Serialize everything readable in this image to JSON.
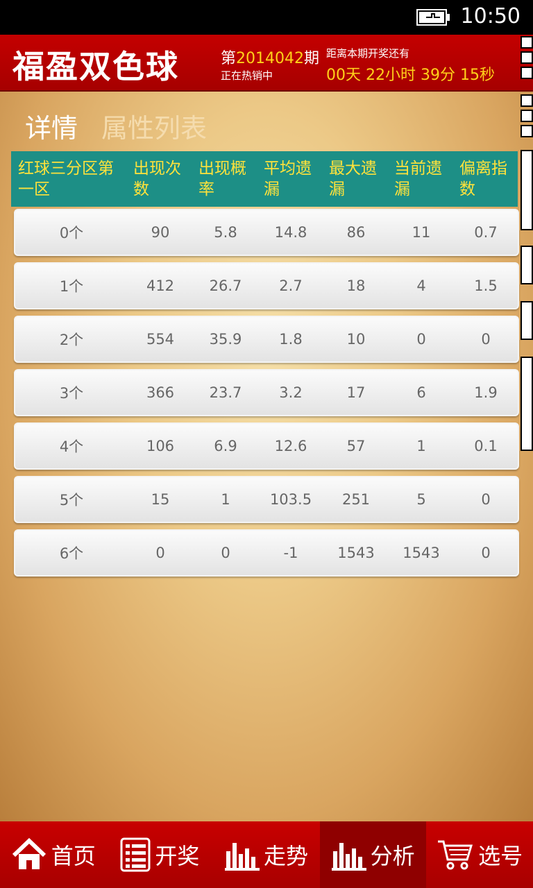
{
  "status": {
    "time": "10:50"
  },
  "header": {
    "title": "福盈双色球",
    "issue_prefix": "第",
    "issue_number": "2014042",
    "issue_suffix": "期",
    "issue_status": "正在热销中",
    "countdown_label": "距离本期开奖还有",
    "countdown": "00天 22小时 39分 15秒"
  },
  "pivot": {
    "tabs": [
      {
        "label": "详情",
        "active": true
      },
      {
        "label": "属性列表",
        "active": false
      }
    ]
  },
  "table": {
    "headers": [
      "红球三分区第一区",
      "出现次数",
      "出现概率",
      "平均遗漏",
      "最大遗漏",
      "当前遗漏",
      "偏离指数"
    ],
    "rows": [
      [
        "0个",
        "90",
        "5.8",
        "14.8",
        "86",
        "11",
        "0.7"
      ],
      [
        "1个",
        "412",
        "26.7",
        "2.7",
        "18",
        "4",
        "1.5"
      ],
      [
        "2个",
        "554",
        "35.9",
        "1.8",
        "10",
        "0",
        "0"
      ],
      [
        "3个",
        "366",
        "23.7",
        "3.2",
        "17",
        "6",
        "1.9"
      ],
      [
        "4个",
        "106",
        "6.9",
        "12.6",
        "57",
        "1",
        "0.1"
      ],
      [
        "5个",
        "15",
        "1",
        "103.5",
        "251",
        "5",
        "0"
      ],
      [
        "6个",
        "0",
        "0",
        "-1",
        "1543",
        "1543",
        "0"
      ]
    ]
  },
  "nav": {
    "items": [
      {
        "label": "首页",
        "icon": "home-icon"
      },
      {
        "label": "开奖",
        "icon": "list-icon"
      },
      {
        "label": "走势",
        "icon": "bar-chart-icon"
      },
      {
        "label": "分析",
        "icon": "bar-chart-icon",
        "active": true
      },
      {
        "label": "选号",
        "icon": "cart-icon"
      }
    ]
  },
  "colors": {
    "header_red": "#c40000",
    "table_header_teal": "#1d8f86",
    "highlight_yellow": "#ffd21a"
  }
}
